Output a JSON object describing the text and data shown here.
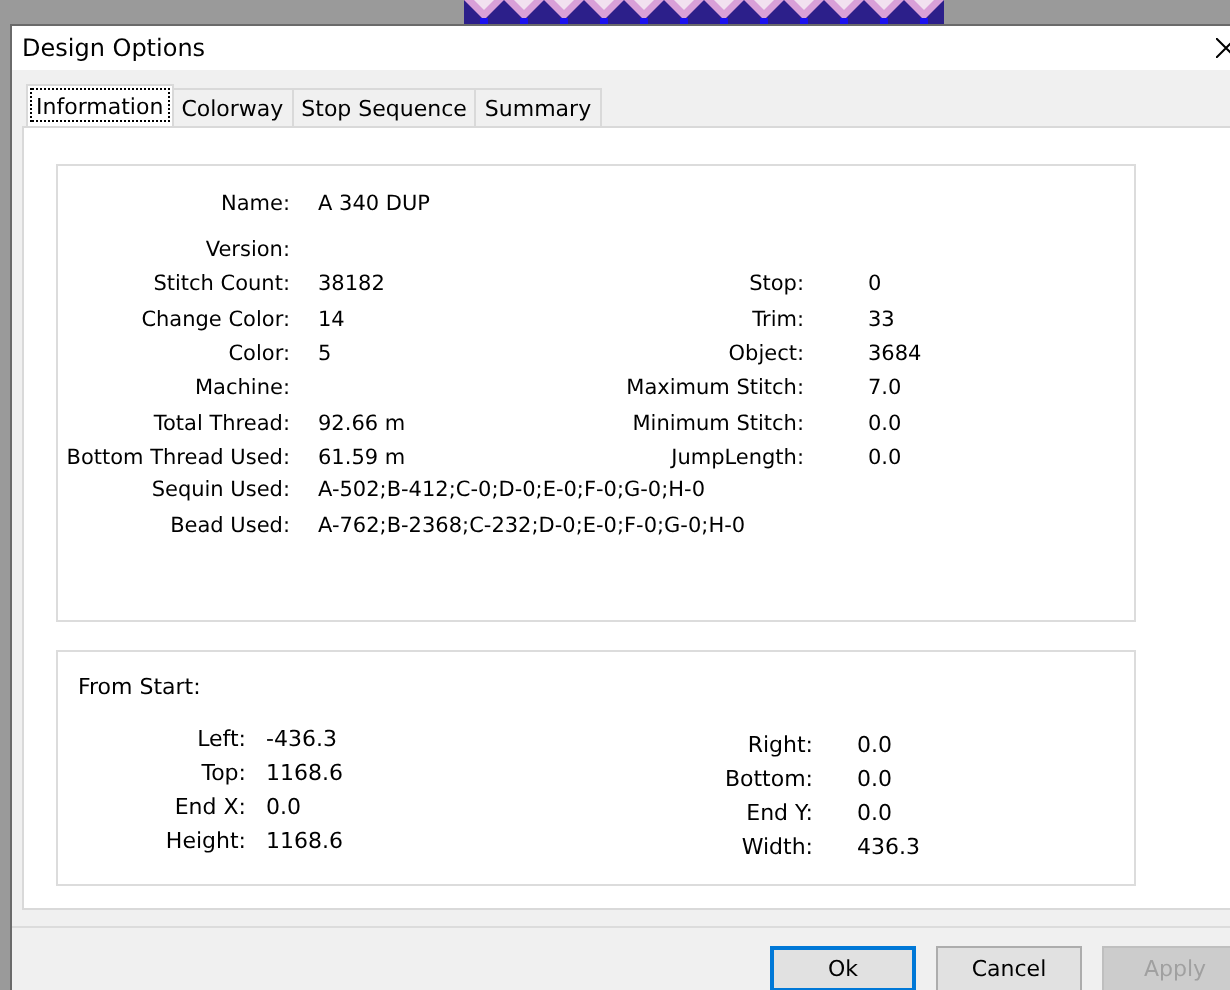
{
  "window": {
    "title": "Design Options"
  },
  "tabs": [
    {
      "label": "Information",
      "selected": true
    },
    {
      "label": "Colorway",
      "selected": false
    },
    {
      "label": "Stop Sequence",
      "selected": false
    },
    {
      "label": "Summary",
      "selected": false
    }
  ],
  "information": {
    "rows": [
      {
        "label": "Name:",
        "value": "A 340 DUP"
      },
      {
        "label": "Version:"
      },
      {
        "label": "Stitch Count:",
        "value": "38182",
        "right_label": "Stop:",
        "right_value": "0"
      },
      {
        "label": "Change Color:",
        "value": "14",
        "right_label": "Trim:",
        "right_value": "33"
      },
      {
        "label": "Color:",
        "value": "5",
        "right_label": "Object:",
        "right_value": "3684"
      },
      {
        "label": "Machine:",
        "right_label": "Maximum Stitch:",
        "right_value": "7.0"
      },
      {
        "label": "Total Thread:",
        "value": "92.66 m",
        "right_label": "Minimum Stitch:",
        "right_value": "0.0"
      },
      {
        "label": "Bottom Thread Used:",
        "value": "61.59 m",
        "right_label": "JumpLength:",
        "right_value": "0.0"
      },
      {
        "label": "Sequin Used:",
        "value": "A-502;B-412;C-0;D-0;E-0;F-0;G-0;H-0"
      },
      {
        "label": "Bead Used:",
        "value": "A-762;B-2368;C-232;D-0;E-0;F-0;G-0;H-0"
      }
    ]
  },
  "from_start": {
    "title": "From Start:",
    "left": [
      {
        "label": "Left:",
        "value": "-436.3"
      },
      {
        "label": "Top:",
        "value": "1168.6"
      },
      {
        "label": "End X:",
        "value": "0.0"
      },
      {
        "label": "Height:",
        "value": "1168.6"
      }
    ],
    "right": [
      {
        "label": "Right:",
        "value": "0.0"
      },
      {
        "label": "Bottom:",
        "value": "0.0"
      },
      {
        "label": "End Y:",
        "value": "0.0"
      },
      {
        "label": "Width:",
        "value": "436.3"
      }
    ]
  },
  "buttons": [
    {
      "label": "Ok",
      "default": true,
      "disabled": false
    },
    {
      "label": "Cancel",
      "default": false,
      "disabled": false
    },
    {
      "label": "Apply",
      "default": false,
      "disabled": true
    }
  ]
}
